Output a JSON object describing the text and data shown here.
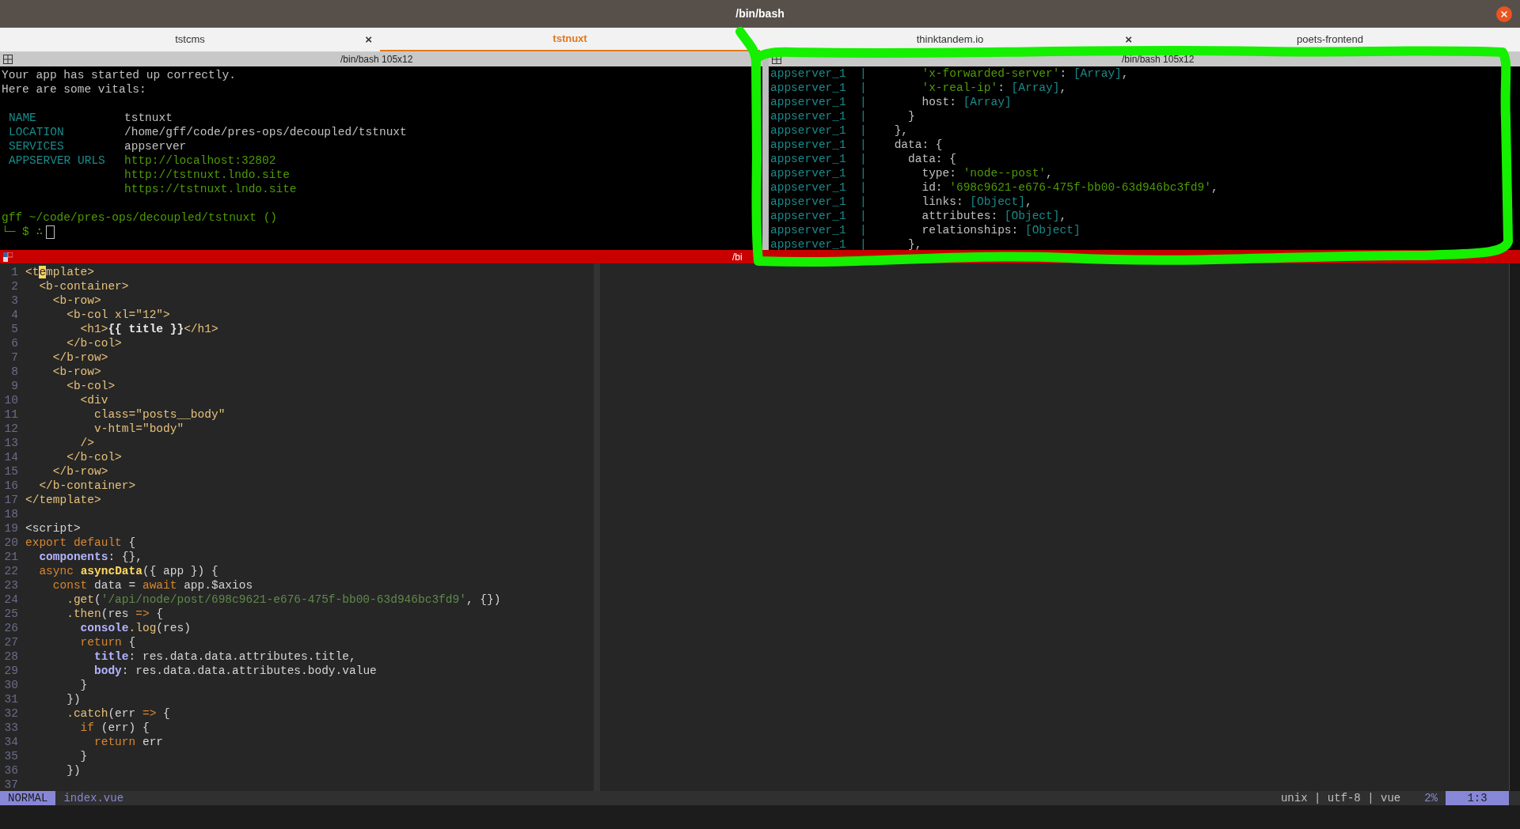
{
  "window": {
    "title": "/bin/bash"
  },
  "tabs": [
    {
      "label": "tstcms",
      "selected": false,
      "close": "×"
    },
    {
      "label": "tstnuxt",
      "selected": true
    },
    {
      "label": "thinktandem.io",
      "selected": false,
      "close": "×"
    },
    {
      "label": "poets-frontend",
      "selected": false
    }
  ],
  "left_pane": {
    "header": "/bin/bash 105x12",
    "message": [
      "Your app has started up correctly.",
      "Here are some vitals:"
    ],
    "vitals": [
      {
        "label": "NAME",
        "values": [
          "tstnuxt"
        ],
        "kind": "plain"
      },
      {
        "label": "LOCATION",
        "values": [
          "/home/gff/code/pres-ops/decoupled/tstnuxt"
        ],
        "kind": "plain"
      },
      {
        "label": "SERVICES",
        "values": [
          "appserver"
        ],
        "kind": "plain"
      },
      {
        "label": "APPSERVER URLS",
        "values": [
          "http://localhost:32802",
          "http://tstnuxt.lndo.site",
          "https://tstnuxt.lndo.site"
        ],
        "kind": "url"
      }
    ],
    "prompt": {
      "path": "gff ~/code/pres-ops/decoupled/tstnuxt ()",
      "line": "└─ $ ∴"
    }
  },
  "right_pane": {
    "header": "/bin/bash 105x12",
    "lines": [
      {
        "source": "appserver_1  |",
        "segments": [
          {
            "kind": "string",
            "text": "        'x-forwarded-server'"
          },
          {
            "kind": "plain",
            "text": ": "
          },
          {
            "kind": "teal",
            "text": "[Array]"
          },
          {
            "kind": "plain",
            "text": ","
          }
        ]
      },
      {
        "source": "appserver_1  |",
        "segments": [
          {
            "kind": "string",
            "text": "        'x-real-ip'"
          },
          {
            "kind": "plain",
            "text": ": "
          },
          {
            "kind": "teal",
            "text": "[Array]"
          },
          {
            "kind": "plain",
            "text": ","
          }
        ]
      },
      {
        "source": "appserver_1  |",
        "segments": [
          {
            "kind": "plain",
            "text": "        host: "
          },
          {
            "kind": "teal",
            "text": "[Array]"
          }
        ]
      },
      {
        "source": "appserver_1  |",
        "segments": [
          {
            "kind": "plain",
            "text": "      }"
          }
        ]
      },
      {
        "source": "appserver_1  |",
        "segments": [
          {
            "kind": "plain",
            "text": "    },"
          }
        ]
      },
      {
        "source": "appserver_1  |",
        "segments": [
          {
            "kind": "plain",
            "text": "    data: {"
          }
        ]
      },
      {
        "source": "appserver_1  |",
        "segments": [
          {
            "kind": "plain",
            "text": "      data: {"
          }
        ]
      },
      {
        "source": "appserver_1  |",
        "segments": [
          {
            "kind": "plain",
            "text": "        type: "
          },
          {
            "kind": "string",
            "text": "'node--post'"
          },
          {
            "kind": "plain",
            "text": ","
          }
        ]
      },
      {
        "source": "appserver_1  |",
        "segments": [
          {
            "kind": "plain",
            "text": "        id: "
          },
          {
            "kind": "string",
            "text": "'698c9621-e676-475f-bb00-63d946bc3fd9'"
          },
          {
            "kind": "plain",
            "text": ","
          }
        ]
      },
      {
        "source": "appserver_1  |",
        "segments": [
          {
            "kind": "plain",
            "text": "        links: "
          },
          {
            "kind": "teal",
            "text": "[Object]"
          },
          {
            "kind": "plain",
            "text": ","
          }
        ]
      },
      {
        "source": "appserver_1  |",
        "segments": [
          {
            "kind": "plain",
            "text": "        attributes: "
          },
          {
            "kind": "teal",
            "text": "[Object]"
          },
          {
            "kind": "plain",
            "text": ","
          }
        ]
      },
      {
        "source": "appserver_1  |",
        "segments": [
          {
            "kind": "plain",
            "text": "        relationships: "
          },
          {
            "kind": "teal",
            "text": "[Object]"
          }
        ]
      },
      {
        "source": "appserver_1  |",
        "segments": [
          {
            "kind": "plain",
            "text": "      },"
          }
        ]
      }
    ]
  },
  "editor_header": "/bi",
  "editor": {
    "lines": [
      {
        "number": "1",
        "segments": [
          {
            "kind": "tag",
            "text": "<t"
          },
          {
            "kind": "cursor",
            "text": "e"
          },
          {
            "kind": "tag",
            "text": "mplate>"
          }
        ]
      },
      {
        "number": "2",
        "segments": [
          {
            "kind": "tag",
            "text": "  <b-container>"
          }
        ]
      },
      {
        "number": "3",
        "segments": [
          {
            "kind": "tag",
            "text": "    <b-row>"
          }
        ]
      },
      {
        "number": "4",
        "segments": [
          {
            "kind": "tag",
            "text": "      <b-col xl=\"12\">"
          }
        ]
      },
      {
        "number": "5",
        "segments": [
          {
            "kind": "tag",
            "text": "        <h1>"
          },
          {
            "kind": "bold",
            "text": "{{ title }}"
          },
          {
            "kind": "tag",
            "text": "</h1>"
          }
        ]
      },
      {
        "number": "6",
        "segments": [
          {
            "kind": "tag",
            "text": "      </b-col>"
          }
        ]
      },
      {
        "number": "7",
        "segments": [
          {
            "kind": "tag",
            "text": "    </b-row>"
          }
        ]
      },
      {
        "number": "8",
        "segments": [
          {
            "kind": "tag",
            "text": "    <b-row>"
          }
        ]
      },
      {
        "number": "9",
        "segments": [
          {
            "kind": "tag",
            "text": "      <b-col>"
          }
        ]
      },
      {
        "number": "10",
        "segments": [
          {
            "kind": "tag",
            "text": "        <div"
          }
        ]
      },
      {
        "number": "11",
        "segments": [
          {
            "kind": "tag",
            "text": "          class=\"posts__body\""
          }
        ]
      },
      {
        "number": "12",
        "segments": [
          {
            "kind": "tag",
            "text": "          v-html=\"body\""
          }
        ]
      },
      {
        "number": "13",
        "segments": [
          {
            "kind": "tag",
            "text": "        />"
          }
        ]
      },
      {
        "number": "14",
        "segments": [
          {
            "kind": "tag",
            "text": "      </b-col>"
          }
        ]
      },
      {
        "number": "15",
        "segments": [
          {
            "kind": "tag",
            "text": "    </b-row>"
          }
        ]
      },
      {
        "number": "16",
        "segments": [
          {
            "kind": "tag",
            "text": "  </b-container>"
          }
        ]
      },
      {
        "number": "17",
        "segments": [
          {
            "kind": "tag",
            "text": "</template>"
          }
        ]
      },
      {
        "number": "18"
      },
      {
        "number": "19",
        "segments": [
          {
            "kind": "plain",
            "text": "<script>"
          }
        ]
      },
      {
        "number": "20",
        "segments": [
          {
            "kind": "keyword",
            "text": "export default "
          },
          {
            "kind": "plain",
            "text": "{"
          }
        ]
      },
      {
        "number": "21",
        "segments": [
          {
            "kind": "prop",
            "text": "  components"
          },
          {
            "kind": "plain",
            "text": ": {},"
          }
        ]
      },
      {
        "number": "22",
        "segments": [
          {
            "kind": "keyword",
            "text": "  async "
          },
          {
            "kind": "func",
            "text": "asyncData"
          },
          {
            "kind": "plain",
            "text": "({ app }) {"
          }
        ]
      },
      {
        "number": "23",
        "segments": [
          {
            "kind": "keyword",
            "text": "    const "
          },
          {
            "kind": "plain",
            "text": "data = "
          },
          {
            "kind": "keyword",
            "text": "await "
          },
          {
            "kind": "plain",
            "text": "app.$axios"
          }
        ]
      },
      {
        "number": "24",
        "segments": [
          {
            "kind": "tag",
            "text": "      .get"
          },
          {
            "kind": "plain",
            "text": "("
          },
          {
            "kind": "string",
            "text": "'/api/node/post/698c9621-e676-475f-bb00-63d946bc3fd9'"
          },
          {
            "kind": "plain",
            "text": ", {})"
          }
        ]
      },
      {
        "number": "25",
        "segments": [
          {
            "kind": "tag",
            "text": "      .then"
          },
          {
            "kind": "plain",
            "text": "(res "
          },
          {
            "kind": "keyword",
            "text": "=>"
          },
          {
            "kind": "plain",
            "text": " {"
          }
        ]
      },
      {
        "number": "26",
        "segments": [
          {
            "kind": "prop",
            "text": "        console"
          },
          {
            "kind": "tag",
            "text": ".log"
          },
          {
            "kind": "plain",
            "text": "(res)"
          }
        ]
      },
      {
        "number": "27",
        "segments": [
          {
            "kind": "keyword",
            "text": "        return "
          },
          {
            "kind": "plain",
            "text": "{"
          }
        ]
      },
      {
        "number": "28",
        "segments": [
          {
            "kind": "prop",
            "text": "          title"
          },
          {
            "kind": "plain",
            "text": ": res.data.data.attributes.title,"
          }
        ]
      },
      {
        "number": "29",
        "segments": [
          {
            "kind": "prop",
            "text": "          body"
          },
          {
            "kind": "plain",
            "text": ": res.data.data.attributes.body.value"
          }
        ]
      },
      {
        "number": "30",
        "segments": [
          {
            "kind": "plain",
            "text": "        }"
          }
        ]
      },
      {
        "number": "31",
        "segments": [
          {
            "kind": "plain",
            "text": "      })"
          }
        ]
      },
      {
        "number": "32",
        "segments": [
          {
            "kind": "tag",
            "text": "      .catch"
          },
          {
            "kind": "plain",
            "text": "(err "
          },
          {
            "kind": "keyword",
            "text": "=>"
          },
          {
            "kind": "plain",
            "text": " {"
          }
        ]
      },
      {
        "number": "33",
        "segments": [
          {
            "kind": "keyword",
            "text": "        if "
          },
          {
            "kind": "plain",
            "text": "(err) {"
          }
        ]
      },
      {
        "number": "34",
        "segments": [
          {
            "kind": "keyword",
            "text": "          return "
          },
          {
            "kind": "plain",
            "text": "err"
          }
        ]
      },
      {
        "number": "35",
        "segments": [
          {
            "kind": "plain",
            "text": "        }"
          }
        ]
      },
      {
        "number": "36",
        "segments": [
          {
            "kind": "plain",
            "text": "      })"
          }
        ]
      },
      {
        "number": "37"
      }
    ]
  },
  "status_bar": {
    "mode": "NORMAL",
    "file": "index.vue",
    "info": "unix | utf-8 | vue",
    "percent": "2%",
    "position": "1:3"
  }
}
